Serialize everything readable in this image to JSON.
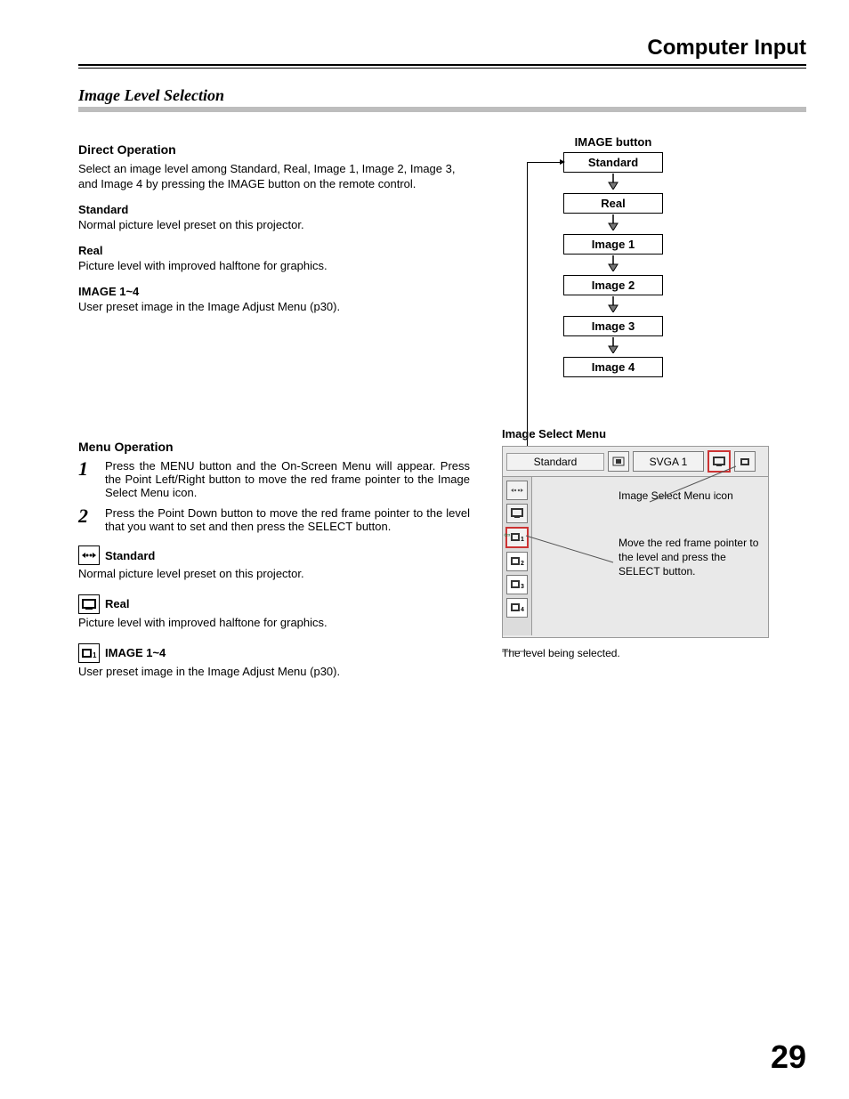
{
  "header": {
    "title": "Computer Input"
  },
  "section": {
    "title": "Image Level Selection"
  },
  "direct": {
    "heading": "Direct Operation",
    "intro": "Select an image level among Standard, Real, Image 1, Image 2, Image 3, and Image 4 by pressing the IMAGE button on the remote control.",
    "items": [
      {
        "name": "Standard",
        "desc": "Normal picture level preset on this projector."
      },
      {
        "name": "Real",
        "desc": "Picture level with improved halftone for graphics."
      },
      {
        "name": "IMAGE 1~4",
        "desc": "User preset image in the Image Adjust Menu (p30)."
      }
    ]
  },
  "flow": {
    "label": "IMAGE button",
    "boxes": [
      "Standard",
      "Real",
      "Image 1",
      "Image 2",
      "Image 3",
      "Image 4"
    ]
  },
  "menu_op": {
    "heading": "Menu Operation",
    "steps": [
      "Press the MENU button and the On-Screen Menu will appear. Press the Point Left/Right button to move the red frame pointer to the Image Select Menu icon.",
      "Press the Point Down button to move the red frame pointer to the level that you want to set and then press the SELECT button."
    ],
    "items": [
      {
        "name": "Standard",
        "desc": "Normal picture level preset on this projector."
      },
      {
        "name": "Real",
        "desc": "Picture level with improved halftone for graphics."
      },
      {
        "name": "IMAGE 1~4",
        "desc": "User preset image in the Image Adjust Menu (p30)."
      }
    ]
  },
  "menu_shot": {
    "title": "Image Select Menu",
    "top_label": "Standard",
    "signal": "SVGA 1",
    "note1": "Image Select Menu icon",
    "note2": "Move the red frame pointer to the level and press the SELECT button.",
    "caption": "The level being selected."
  },
  "page_number": "29"
}
